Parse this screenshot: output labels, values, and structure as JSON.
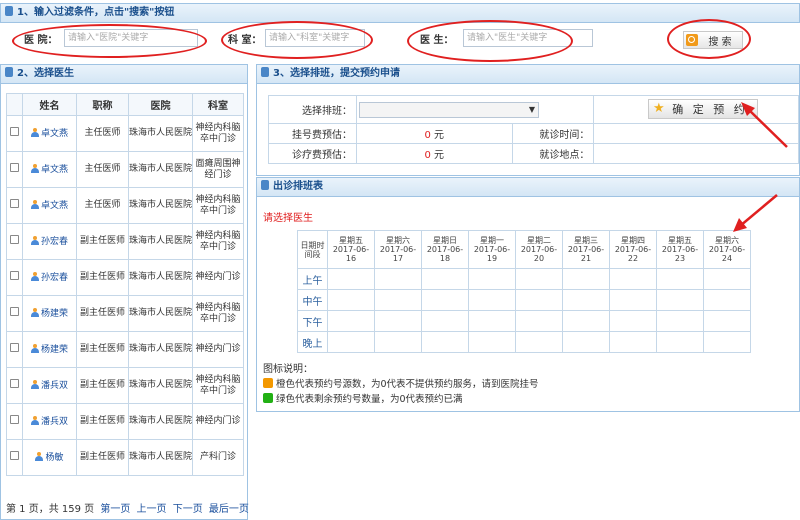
{
  "filter": {
    "title": "1、输入过滤条件，点击\"搜索\"按钮",
    "hospital_label": "医 院：",
    "hospital_placeholder": "请输入\"医院\"关键字",
    "department_label": "科 室：",
    "department_placeholder": "请输入\"科室\"关键字",
    "doctor_label": "医 生：",
    "doctor_placeholder": "请输入\"医生\"关键字",
    "search_label": "搜 索"
  },
  "doctor_panel": {
    "title": "2、选择医生",
    "headers": [
      "姓名",
      "职称",
      "医院",
      "科室"
    ],
    "rows": [
      {
        "name": "卓文燕",
        "title": "主任医师",
        "hospital": "珠海市人民医院",
        "dept": "神经内科脑卒中门诊"
      },
      {
        "name": "卓文燕",
        "title": "主任医师",
        "hospital": "珠海市人民医院",
        "dept": "面瘫周围神经门诊"
      },
      {
        "name": "卓文燕",
        "title": "主任医师",
        "hospital": "珠海市人民医院",
        "dept": "神经内科脑卒中门诊"
      },
      {
        "name": "孙宏春",
        "title": "副主任医师",
        "hospital": "珠海市人民医院",
        "dept": "神经内科脑卒中门诊"
      },
      {
        "name": "孙宏春",
        "title": "副主任医师",
        "hospital": "珠海市人民医院",
        "dept": "神经内门诊"
      },
      {
        "name": "杨建荣",
        "title": "副主任医师",
        "hospital": "珠海市人民医院",
        "dept": "神经内科脑卒中门诊"
      },
      {
        "name": "杨建荣",
        "title": "副主任医师",
        "hospital": "珠海市人民医院",
        "dept": "神经内门诊"
      },
      {
        "name": "潘兵双",
        "title": "副主任医师",
        "hospital": "珠海市人民医院",
        "dept": "神经内科脑卒中门诊"
      },
      {
        "name": "潘兵双",
        "title": "副主任医师",
        "hospital": "珠海市人民医院",
        "dept": "神经内门诊"
      },
      {
        "name": "杨敏",
        "title": "副主任医师",
        "hospital": "珠海市人民医院",
        "dept": "产科门诊"
      }
    ],
    "pager": {
      "text": "第 1 页，共 159 页",
      "first": "第一页",
      "prev": "上一页",
      "next": "下一页",
      "last": "最后一页"
    }
  },
  "booking": {
    "title": "3、选择排班，提交预约申请",
    "schedule_label": "选择排班：",
    "reg_fee_label": "挂号费预估：",
    "reg_fee_value": "0",
    "reg_fee_unit": "元",
    "diag_fee_label": "诊疗费预估：",
    "diag_fee_value": "0",
    "diag_fee_unit": "元",
    "visit_time_label": "就诊时间：",
    "visit_place_label": "就诊地点：",
    "confirm_label": "确 定 预 约"
  },
  "schedule": {
    "title": "出诊排班表",
    "hint": "请选择医生",
    "corner_header": "日期时间段",
    "days": [
      {
        "weekday": "星期五",
        "date": "2017-06-16"
      },
      {
        "weekday": "星期六",
        "date": "2017-06-17"
      },
      {
        "weekday": "星期日",
        "date": "2017-06-18"
      },
      {
        "weekday": "星期一",
        "date": "2017-06-19"
      },
      {
        "weekday": "星期二",
        "date": "2017-06-20"
      },
      {
        "weekday": "星期三",
        "date": "2017-06-21"
      },
      {
        "weekday": "星期四",
        "date": "2017-06-22"
      },
      {
        "weekday": "星期五",
        "date": "2017-06-23"
      },
      {
        "weekday": "星期六",
        "date": "2017-06-24"
      }
    ],
    "periods": [
      "上午",
      "中午",
      "下午",
      "晚上"
    ]
  },
  "legend": {
    "title": "图标说明：",
    "orange_text": "橙色代表预约号源数，为0代表不提供预约服务，请到医院挂号",
    "green_text": "绿色代表剩余预约号数量，为0代表预约已满",
    "orange_color": "#f39800",
    "green_color": "#22b014"
  },
  "colors": {
    "accent_red": "#e02020",
    "header_blue": "#1a4f8c"
  }
}
